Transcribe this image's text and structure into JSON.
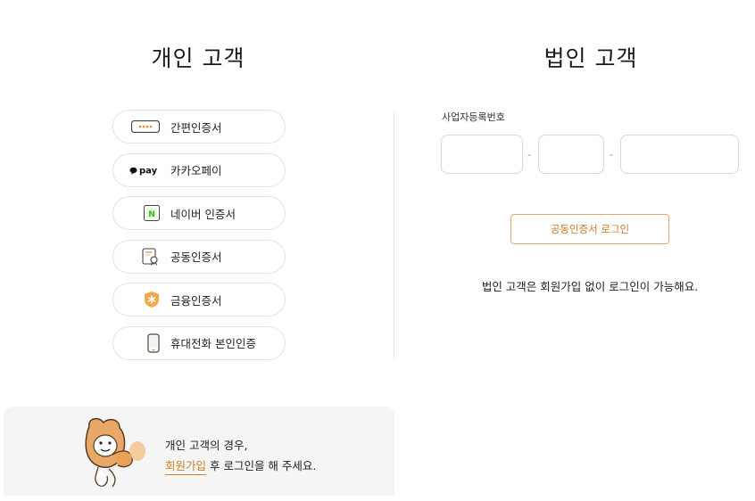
{
  "personal": {
    "title": "개인 고객",
    "methods": [
      {
        "label": "간편인증서",
        "icon": "simple-cert-icon"
      },
      {
        "label": "카카오페이",
        "icon": "kakaopay-icon"
      },
      {
        "label": "네이버 인증서",
        "icon": "naver-icon"
      },
      {
        "label": "공동인증서",
        "icon": "joint-cert-icon"
      },
      {
        "label": "금융인증서",
        "icon": "finance-cert-icon"
      },
      {
        "label": "휴대전화 본인인증",
        "icon": "mobile-phone-icon"
      }
    ],
    "kakaopay_badge": "pay",
    "naver_badge": "N",
    "banner": {
      "line1": "개인 고객의 경우,",
      "signup_link": "회원가입",
      "line2_rest": " 후 로그인을 해 주세요."
    }
  },
  "corporate": {
    "title": "법인 고객",
    "brn_label": "사업자등록번호",
    "dash": "-",
    "cert_login_button": "공동인증서 로그인",
    "note": "법인 고객은 회원가입 없이 로그인이 가능해요."
  },
  "colors": {
    "accent": "#d07d27",
    "button_border": "#e2a667",
    "finance_icon": "#f0a94b",
    "naver_green": "#1ec800",
    "banner_bg": "#f5f5f5"
  }
}
